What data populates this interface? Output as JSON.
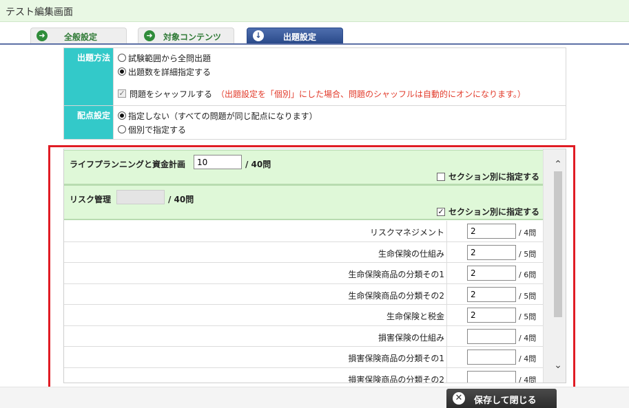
{
  "window": {
    "title": "テスト編集画面"
  },
  "tabs": [
    {
      "label": "全般設定",
      "icon": "arrow-right-icon"
    },
    {
      "label": "対象コンテンツ",
      "icon": "arrow-right-icon"
    },
    {
      "label": "出題設定",
      "icon": "arrow-down-icon",
      "active": true
    }
  ],
  "settings": {
    "method": {
      "header": "出題方法",
      "options": [
        "試験範囲から全問出題",
        "出題数を詳細指定する"
      ],
      "selected": 1,
      "shuffle_label": "問題をシャッフルする",
      "shuffle_note": "（出題設定を「個別」にした場合、問題のシャッフルは自動的にオンになります。）",
      "shuffle_checked": true
    },
    "scoring": {
      "header": "配点設定",
      "options": [
        "指定しない（すべての問題が同じ配点になります）",
        "個別で指定する"
      ],
      "selected": 0
    }
  },
  "sections": [
    {
      "name": "ライフプランニングと資金計画",
      "value": "10",
      "max": "/ 40問",
      "section_label": "セクション別に指定する",
      "section_checked": false
    },
    {
      "name": "リスク管理",
      "value": "",
      "max": "/ 40問",
      "section_label": "セクション別に指定する",
      "section_checked": true
    }
  ],
  "subsections": [
    {
      "name": "リスクマネジメント",
      "value": "2",
      "max": "/ 4問"
    },
    {
      "name": "生命保険の仕組み",
      "value": "2",
      "max": "/ 5問"
    },
    {
      "name": "生命保険商品の分類その1",
      "value": "2",
      "max": "/ 6問"
    },
    {
      "name": "生命保険商品の分類その2",
      "value": "2",
      "max": "/ 5問"
    },
    {
      "name": "生命保険と税金",
      "value": "2",
      "max": "/ 5問"
    },
    {
      "name": "損害保険の仕組み",
      "value": "",
      "max": "/ 4問"
    },
    {
      "name": "損害保険商品の分類その1",
      "value": "",
      "max": "/ 4問"
    },
    {
      "name": "損害保険商品の分類その2",
      "value": "",
      "max": "/ 4問"
    }
  ],
  "footer": {
    "save_label": "保存して閉じる",
    "save_icon": "close-circle-icon"
  },
  "colors": {
    "accent_teal": "#33c9c9",
    "section_green": "#dff8d8",
    "highlight_red": "#e01c24",
    "note_red": "#e23a2a",
    "tab_active": "#2a4a8a"
  }
}
